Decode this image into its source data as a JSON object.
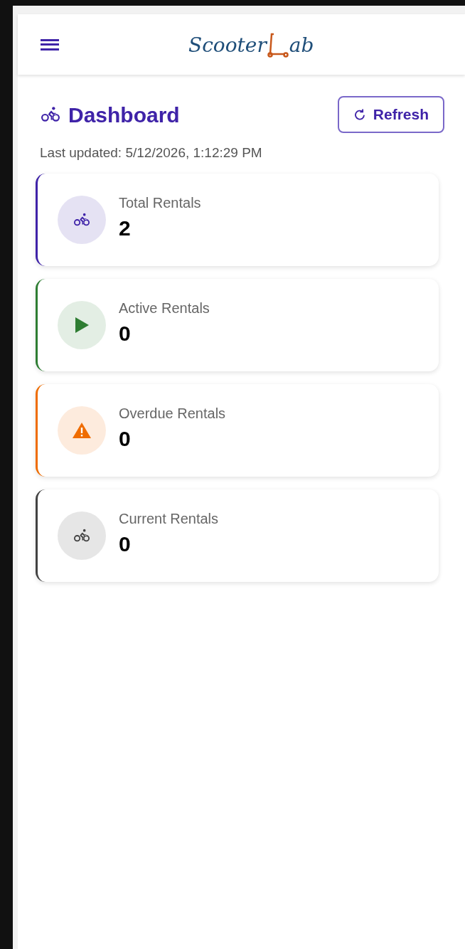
{
  "header": {
    "logo_before": "Scooter",
    "logo_after": "ab"
  },
  "page": {
    "title": "Dashboard",
    "refresh_button": "Refresh",
    "last_updated": "Last updated: 5/12/2026, 1:12:29 PM"
  },
  "stats": [
    {
      "label": "Total Rentals",
      "value": "2",
      "kind": "bike",
      "color": "#3f23a8"
    },
    {
      "label": "Active Rentals",
      "value": "0",
      "kind": "play",
      "color": "#2e7d32"
    },
    {
      "label": "Overdue Rentals",
      "value": "0",
      "kind": "warning",
      "color": "#ef6c00"
    },
    {
      "label": "Current Rentals",
      "value": "0",
      "kind": "bike",
      "color": "#424242"
    }
  ]
}
